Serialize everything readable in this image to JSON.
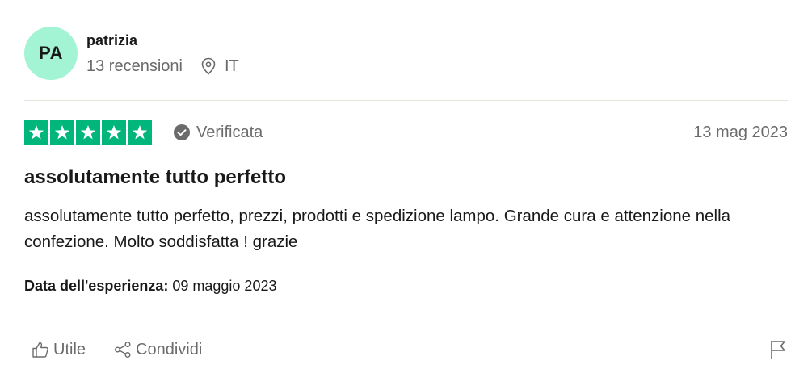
{
  "reviewer": {
    "initials": "PA",
    "name": "patrizia",
    "reviews_count": "13 recensioni",
    "location_icon": "location-pin-icon",
    "country": "IT",
    "avatar_color": "#a3f4d4"
  },
  "review": {
    "rating": 5,
    "rating_max": 5,
    "star_color": "#00b67a",
    "verified_label": "Verificata",
    "date": "13 mag 2023",
    "title": "assolutamente tutto perfetto",
    "body": "assolutamente tutto perfetto, prezzi, prodotti e spedizione lampo. Grande cura e attenzione nella confezione. Molto soddisfatta ! grazie",
    "experience_label": "Data dell'esperienza:",
    "experience_date": "09 maggio 2023"
  },
  "actions": {
    "useful_label": "Utile",
    "useful_icon": "thumbs-up-icon",
    "share_label": "Condividi",
    "share_icon": "share-icon",
    "flag_icon": "flag-icon"
  }
}
